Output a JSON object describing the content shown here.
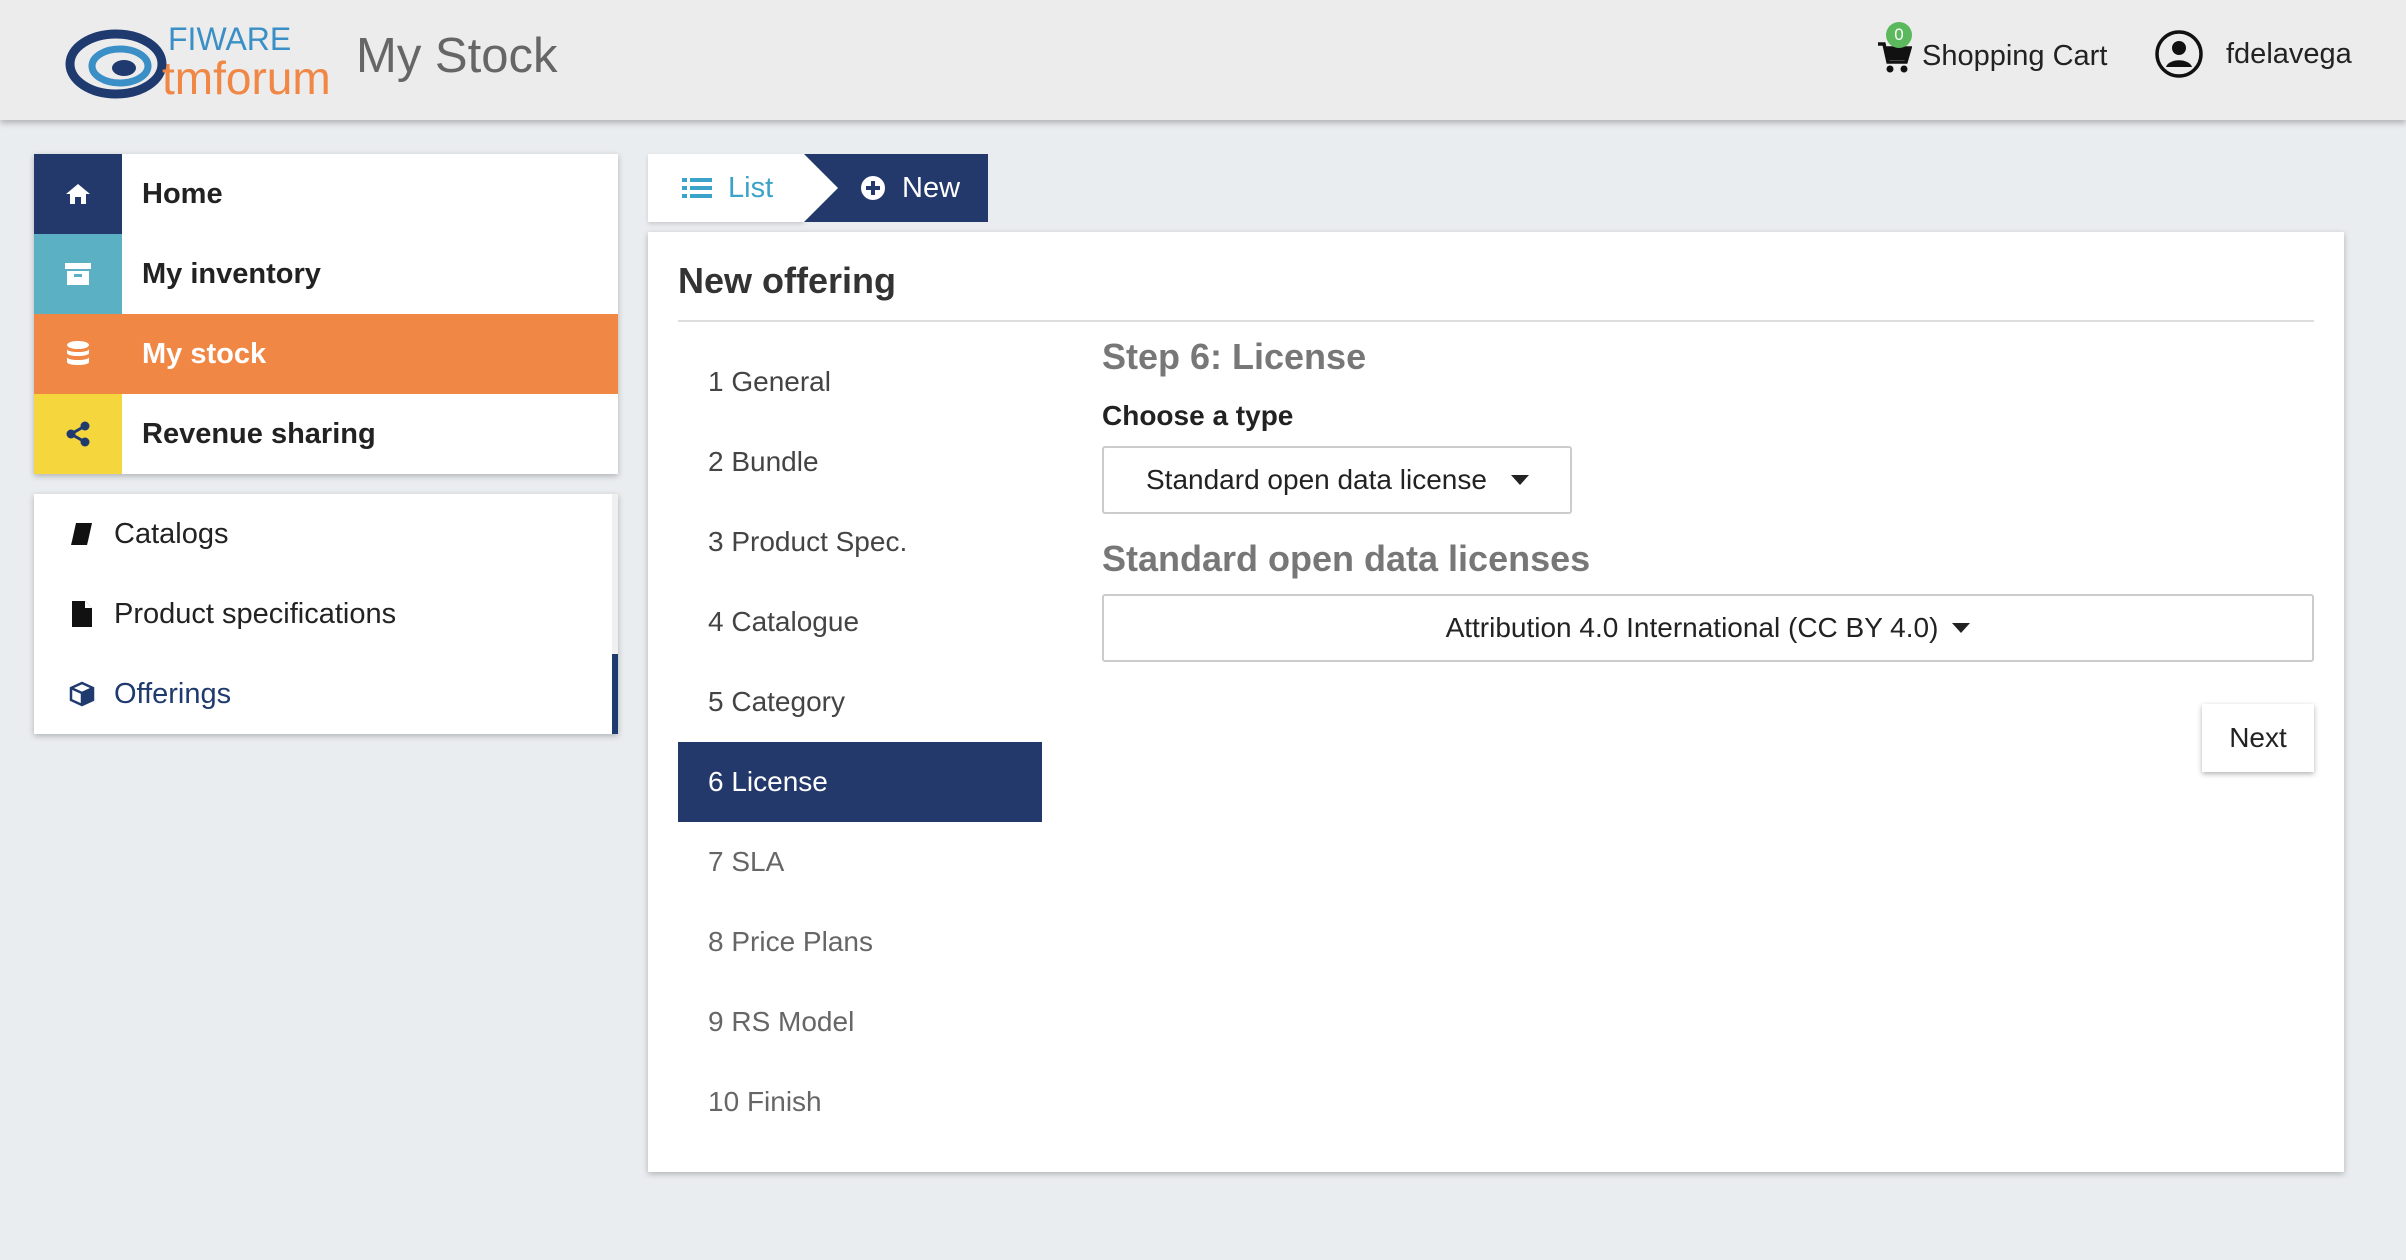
{
  "header": {
    "logo_top": "FIWARE",
    "logo_bottom": "tmforum",
    "app_title": "My Stock",
    "cart_count": "0",
    "cart_label": "Shopping Cart",
    "username": "fdelavega"
  },
  "mainnav": {
    "items": [
      {
        "label": "Home",
        "icon": "home-icon",
        "color": "#24396b"
      },
      {
        "label": "My inventory",
        "icon": "archive-icon",
        "color": "#5bb0c4"
      },
      {
        "label": "My stock",
        "icon": "database-icon",
        "color": "#f08745"
      },
      {
        "label": "Revenue sharing",
        "icon": "share-icon",
        "color": "#f5d63d"
      }
    ]
  },
  "subnav": {
    "items": [
      {
        "label": "Catalogs",
        "icon": "book-icon"
      },
      {
        "label": "Product specifications",
        "icon": "file-icon"
      },
      {
        "label": "Offerings",
        "icon": "cube-icon"
      }
    ]
  },
  "breadcrumb": {
    "list_label": "List",
    "new_label": "New"
  },
  "panel": {
    "title": "New offering",
    "steps": [
      {
        "num": "1",
        "label": "General"
      },
      {
        "num": "2",
        "label": "Bundle"
      },
      {
        "num": "3",
        "label": "Product Spec."
      },
      {
        "num": "4",
        "label": "Catalogue"
      },
      {
        "num": "5",
        "label": "Category"
      },
      {
        "num": "6",
        "label": "License"
      },
      {
        "num": "7",
        "label": "SLA"
      },
      {
        "num": "8",
        "label": "Price Plans"
      },
      {
        "num": "9",
        "label": "RS Model"
      },
      {
        "num": "10",
        "label": "Finish"
      }
    ],
    "step_title": "Step 6: License",
    "choose_label": "Choose a type",
    "type_value": "Standard open data license",
    "licenses_title": "Standard open data licenses",
    "license_value": "Attribution 4.0 International (CC BY 4.0)",
    "next_label": "Next"
  },
  "colors": {
    "primary": "#24396b",
    "accent_orange": "#f08745",
    "link_blue": "#3ba3c9",
    "badge_green": "#5cb85c"
  }
}
